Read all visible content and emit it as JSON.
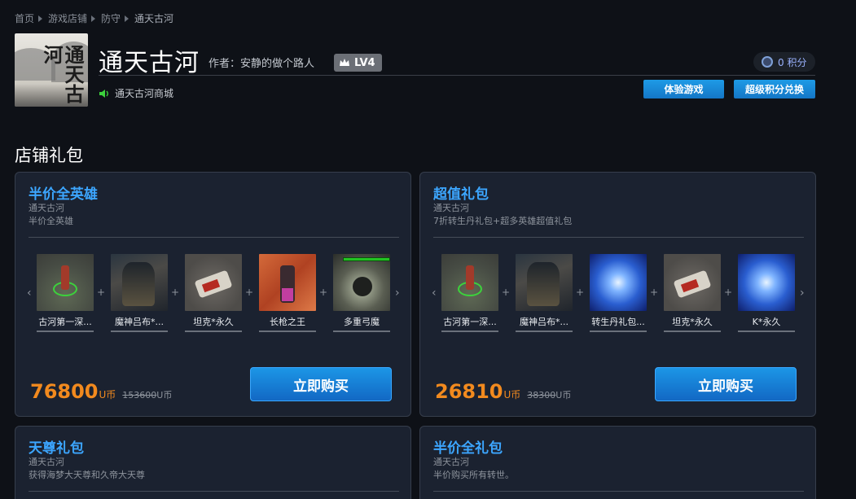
{
  "breadcrumb": [
    "首页",
    "游戏店铺",
    "防守",
    "通天古河"
  ],
  "game": {
    "title": "通天古河",
    "logo_text": "通天古河",
    "author_label": "作者：安静的做个路人",
    "level": "LV4",
    "shop_link": "通天古河商城",
    "points": "0 积分"
  },
  "buttons": {
    "trial": "体验游戏",
    "exchange": "超级积分兑换"
  },
  "section_title": "店铺礼包",
  "cards": [
    {
      "title": "半价全英雄",
      "sub1": "通天古河",
      "sub2": "半价全英雄",
      "items": [
        {
          "label": "古河第一深...",
          "thumb": "hero"
        },
        {
          "label": "魔神吕布*...",
          "thumb": "warrior"
        },
        {
          "label": "坦克*永久",
          "thumb": "tank"
        },
        {
          "label": "长枪之王",
          "thumb": "spear"
        },
        {
          "label": "多重弓魔",
          "thumb": "demon"
        }
      ],
      "price": "76800",
      "unit": "U币",
      "orig_price": "153600",
      "orig_unit": "U币",
      "buy_label": "立即购买"
    },
    {
      "title": "超值礼包",
      "sub1": "通天古河",
      "sub2": "7折转生丹礼包+超多英雄超值礼包",
      "items": [
        {
          "label": "古河第一深...",
          "thumb": "hero"
        },
        {
          "label": "魔神吕布*...",
          "thumb": "warrior"
        },
        {
          "label": "转生丹礼包...",
          "thumb": "swirl"
        },
        {
          "label": "坦克*永久",
          "thumb": "tank"
        },
        {
          "label": "K*永久",
          "thumb": "swirl"
        }
      ],
      "price": "26810",
      "unit": "U币",
      "orig_price": "38300",
      "orig_unit": "U币",
      "buy_label": "立即购买"
    },
    {
      "title": "天尊礼包",
      "sub1": "通天古河",
      "sub2": "获得海梦大天尊和久帝大天尊"
    },
    {
      "title": "半价全礼包",
      "sub1": "通天古河",
      "sub2": "半价购买所有转世。"
    }
  ],
  "icons": {
    "level": "crown-icon",
    "points": "coin-icon",
    "shop": "speaker-icon",
    "nav_prev": "chevron-left-icon",
    "nav_next": "chevron-right-icon",
    "join": "plus-icon"
  },
  "colors": {
    "accent_blue": "#3ca6ff",
    "price_orange": "#f28a1e",
    "button_blue": "#1476c6",
    "speaker_green": "#3cd23c"
  }
}
